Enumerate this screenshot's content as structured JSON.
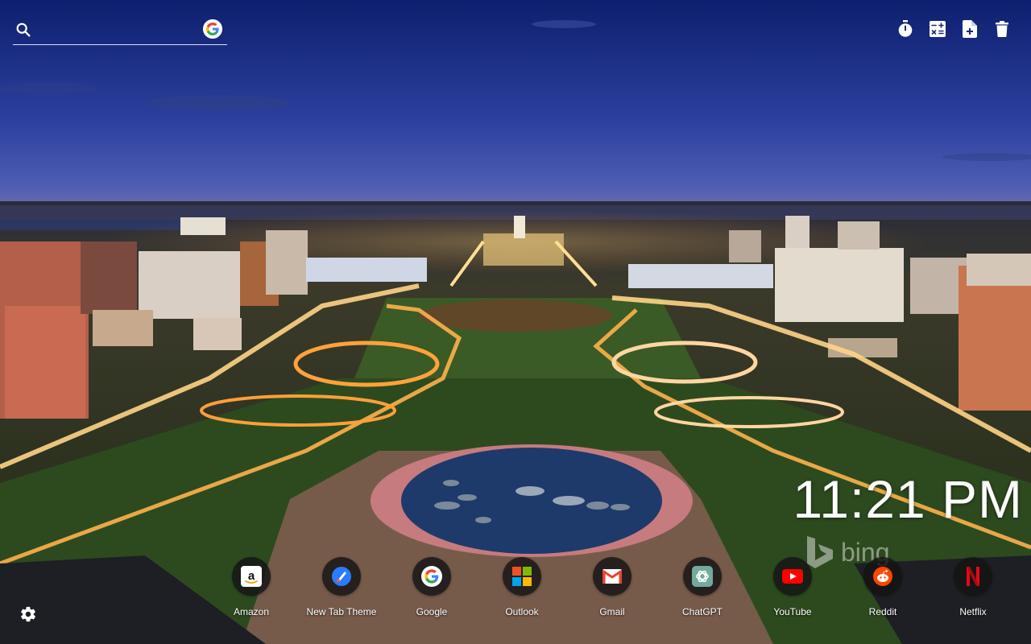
{
  "search": {
    "placeholder": ""
  },
  "toolbar": {
    "buttons": [
      {
        "name": "timer-button",
        "icon": "stopwatch-icon"
      },
      {
        "name": "calculator-button",
        "icon": "calculator-icon"
      },
      {
        "name": "new-note-button",
        "icon": "note-add-icon"
      },
      {
        "name": "delete-button",
        "icon": "trash-icon"
      }
    ]
  },
  "clock": {
    "time": "11:21 PM"
  },
  "wallpaper": {
    "credit": "bing"
  },
  "shortcuts": [
    {
      "label": "Amazon",
      "icon": "amazon-icon"
    },
    {
      "label": "New Tab Theme",
      "icon": "new-tab-theme-icon"
    },
    {
      "label": "Google",
      "icon": "google-icon"
    },
    {
      "label": "Outlook",
      "icon": "microsoft-icon"
    },
    {
      "label": "Gmail",
      "icon": "gmail-icon"
    },
    {
      "label": "ChatGPT",
      "icon": "chatgpt-icon"
    },
    {
      "label": "YouTube",
      "icon": "youtube-icon"
    },
    {
      "label": "Reddit",
      "icon": "reddit-icon"
    },
    {
      "label": "Netflix",
      "icon": "netflix-icon"
    }
  ],
  "colors": {
    "sky_top": "#13267a",
    "sky_bottom": "#4a62b8",
    "lights": "#ffb347"
  }
}
